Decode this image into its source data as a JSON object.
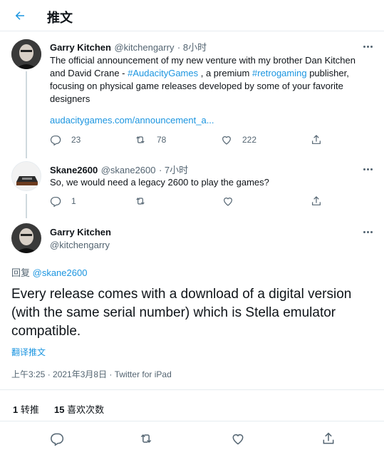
{
  "header": {
    "title": "推文"
  },
  "tweets": [
    {
      "name": "Garry Kitchen",
      "handle": "@kitchengarry",
      "time": "· 8小时",
      "text_a": "The official announcement of my new venture with my brother Dan Kitchen and David Crane - ",
      "hashtag1": "#AudacityGames",
      "text_b": " , a premium ",
      "hashtag2": "#retrogaming",
      "text_c": " publisher, focusing on physical game releases developed by some of your favorite designers",
      "link": "audacitygames.com/announcement_a...",
      "replies": "23",
      "retweets": "78",
      "likes": "222"
    },
    {
      "name": "Skane2600",
      "handle": "@skane2600",
      "time": "· 7小时",
      "text": "So, we would need a legacy 2600 to play the games?",
      "replies": "1"
    }
  ],
  "main": {
    "name": "Garry Kitchen",
    "handle": "@kitchengarry",
    "reply_prefix": "回复 ",
    "reply_to": "@skane2600",
    "text": "Every release comes with a download of a digital version (with the same serial number) which is Stella emulator compatible.",
    "translate": "翻译推文",
    "meta": "上午3:25 · 2021年3月8日 · Twitter for iPad",
    "retweets_count": "1",
    "retweets_label": "转推",
    "likes_count": "15",
    "likes_label": "喜欢次数"
  },
  "colors": {
    "accent": "#1b95e0",
    "text": "#0f1419",
    "secondary": "#536471",
    "border": "#e6ecf0"
  }
}
